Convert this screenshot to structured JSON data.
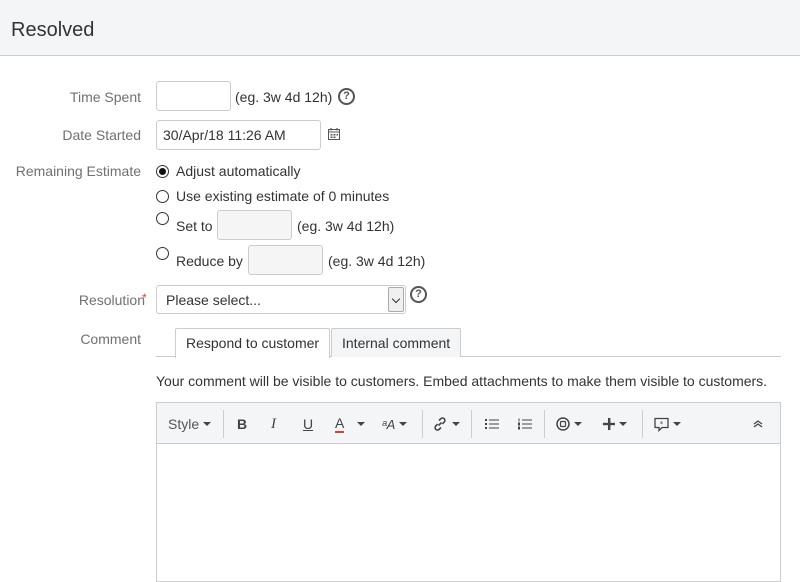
{
  "header": {
    "title": "Resolved"
  },
  "time_spent": {
    "label": "Time Spent",
    "value": "",
    "hint": "(eg. 3w 4d 12h)",
    "help_glyph": "?"
  },
  "date_started": {
    "label": "Date Started",
    "value": "30/Apr/18 11:26 AM"
  },
  "remaining_estimate": {
    "label": "Remaining Estimate",
    "options": [
      {
        "label": "Adjust automatically",
        "selected": true
      },
      {
        "label": "Use existing estimate of 0 minutes",
        "selected": false
      },
      {
        "label": "Set to",
        "selected": false,
        "hint": "(eg. 3w 4d 12h)"
      },
      {
        "label": "Reduce by",
        "selected": false,
        "hint": "(eg. 3w 4d 12h)"
      }
    ]
  },
  "resolution": {
    "label": "Resolution",
    "required_mark": "*",
    "selected": "Please select...",
    "help_glyph": "?"
  },
  "comment": {
    "label": "Comment",
    "tabs": [
      {
        "label": "Respond to customer",
        "active": true
      },
      {
        "label": "Internal comment",
        "active": false
      }
    ],
    "notice": "Your comment will be visible to customers. Embed attachments to make them visible to customers.",
    "toolbar": {
      "style_label": "Style",
      "bold": "B",
      "italic": "I",
      "underline": "U",
      "text_color": "A",
      "text_effects": "ᵃA",
      "icons": [
        "link-icon",
        "bullet-list-icon",
        "numbered-list-icon",
        "emoticon-icon",
        "insert-icon",
        "canned-response-icon",
        "collapse-icon"
      ]
    },
    "body": ""
  },
  "colors": {
    "header_bg": "#f4f5f7",
    "required": "#d04437",
    "text_color_underline": "#d04437"
  }
}
